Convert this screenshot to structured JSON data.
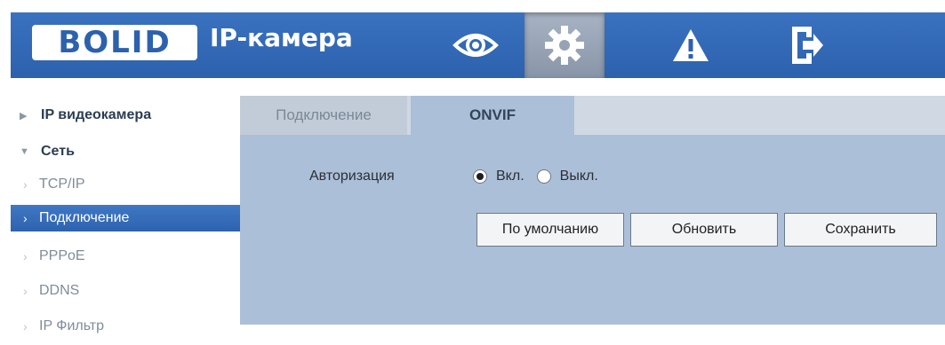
{
  "header": {
    "logo": "BOLID",
    "title": "IP-камера",
    "nav": [
      {
        "icon": "eye-icon"
      },
      {
        "icon": "gear-icon"
      },
      {
        "icon": "warning-icon"
      },
      {
        "icon": "logout-icon"
      }
    ]
  },
  "sidebar": {
    "items": [
      {
        "label": "IP видеокамера"
      },
      {
        "label": "Сеть"
      },
      {
        "label": "TCP/IP"
      },
      {
        "label": "Подключение"
      },
      {
        "label": "PPPoE"
      },
      {
        "label": "DDNS"
      },
      {
        "label": "IP Фильтр"
      }
    ]
  },
  "tabs": [
    {
      "label": "Подключение"
    },
    {
      "label": "ONVIF"
    }
  ],
  "form": {
    "auth_label": "Авторизация",
    "on_label": "Вкл.",
    "off_label": "Выкл.",
    "selected": "on"
  },
  "buttons": {
    "default": "По умолчанию",
    "refresh": "Обновить",
    "save": "Сохранить"
  },
  "colors": {
    "brand": "#2c61ad",
    "content_bg": "#acbfd8",
    "active_nav": "#3f78c4"
  }
}
